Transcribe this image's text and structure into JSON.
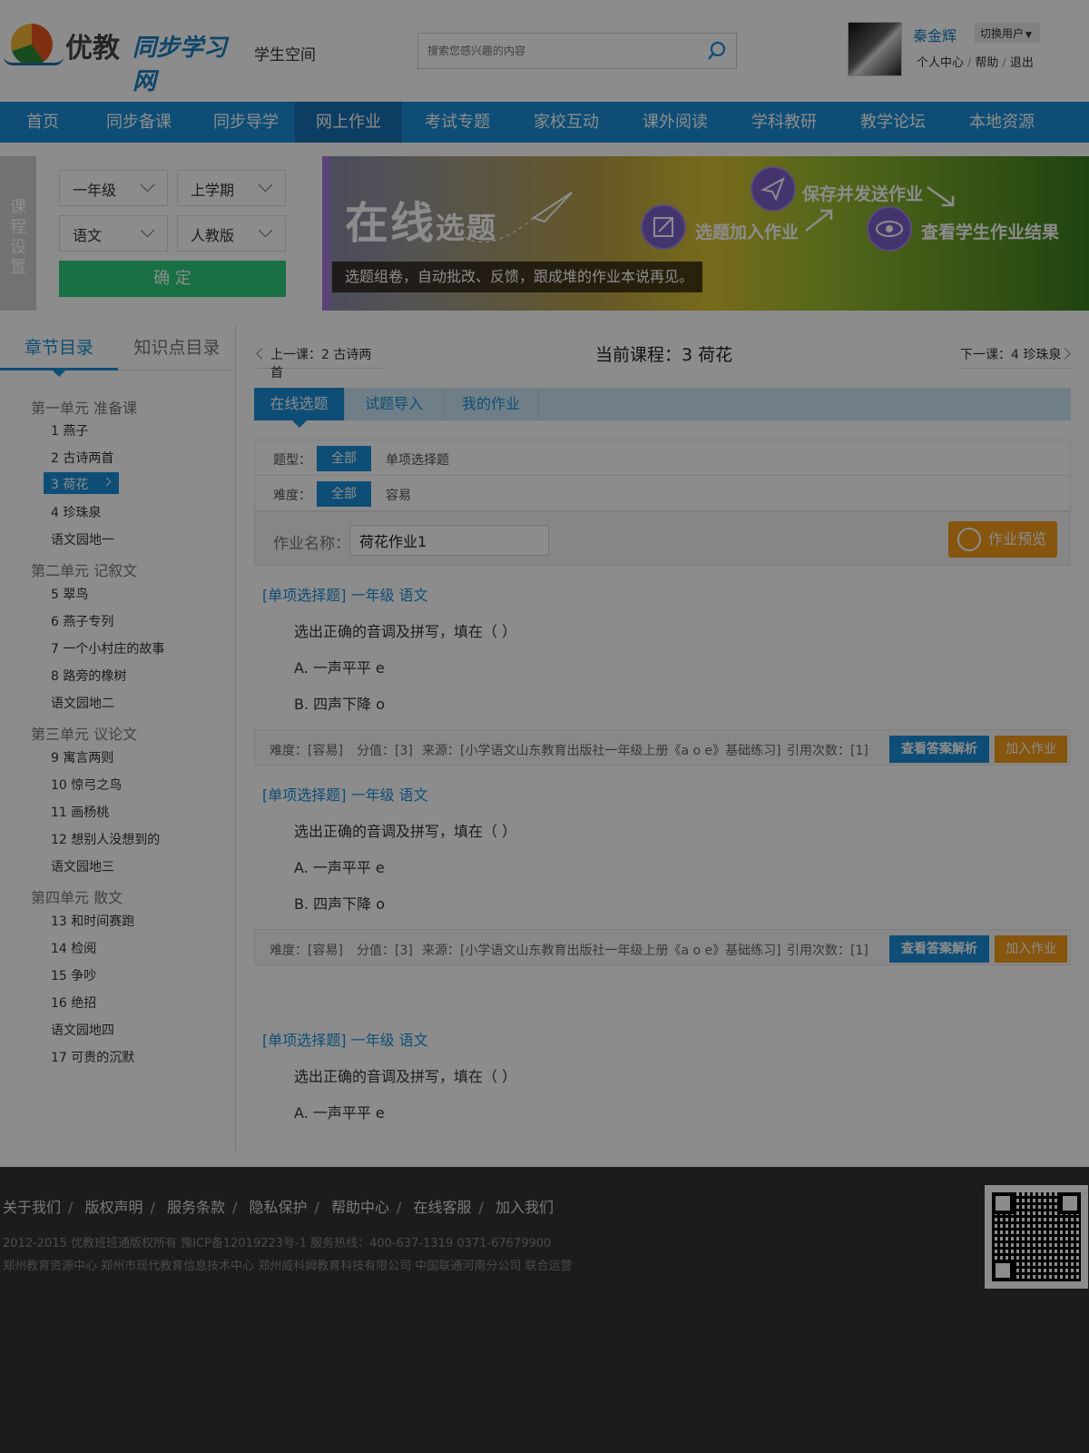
{
  "header": {
    "brand1": "优教",
    "brand2": "同步学习网",
    "space": "学生空间",
    "search_placeholder": "搜索您感兴趣的内容",
    "user_name": "秦金辉",
    "switch_user": "切换用户",
    "links": [
      "个人中心",
      "帮助",
      "退出"
    ]
  },
  "nav": [
    "首页",
    "同步备课",
    "同步导学",
    "网上作业",
    "考试专题",
    "家校互动",
    "课外阅读",
    "学科教研",
    "教学论坛",
    "本地资源"
  ],
  "course": {
    "tab": "课程设置",
    "grade": "一年级",
    "term": "上学期",
    "subject": "语文",
    "edition": "人教版",
    "confirm": "确 定"
  },
  "banner": {
    "title_big": "在线",
    "title_small": "选题",
    "subtitle": "选题组卷，自动批改、反馈，跟成堆的作业本说再见。",
    "step1": "选题加入作业",
    "step2": "保存并发送作业",
    "step3": "查看学生作业结果"
  },
  "tree": {
    "tab_on": "章节目录",
    "tab_off": "知识点目录",
    "units": [
      {
        "name": "第一单元 准备课",
        "lessons": [
          "1 燕子",
          "2 古诗两首",
          "3 荷花",
          "4 珍珠泉",
          "语文园地一"
        ]
      },
      {
        "name": "第二单元 记叙文",
        "lessons": [
          "5 翠鸟",
          "6 燕子专列",
          "7 一个小村庄的故事",
          "8 路旁的橡树",
          "语文园地二"
        ]
      },
      {
        "name": "第三单元 议论文",
        "lessons": [
          "9 寓言两则",
          "10 惊弓之鸟",
          "11 画杨桃",
          "12 想别人没想到的",
          "语文园地三"
        ]
      },
      {
        "name": "第四单元 散文",
        "lessons": [
          "13 和时间赛跑",
          "14 检阅",
          "15 争吵",
          "16 绝招",
          "语文园地四",
          "17 可贵的沉默"
        ]
      }
    ]
  },
  "main": {
    "prev": "上一课：2 古诗两首",
    "current": "当前课程：3 荷花",
    "next": "下一课：4 珍珠泉",
    "tabs": [
      "在线选题",
      "试题导入",
      "我的作业"
    ],
    "type_label": "题型：",
    "all": "全部",
    "type_opt": "单项选择题",
    "diff_label": "难度：",
    "diff_opt": "容易",
    "hw_label": "作业名称：",
    "hw_value": "荷花作业1",
    "preview": "作业预览",
    "q_head": "[单项选择题] 一年级 语文",
    "q_text": "选出正确的音调及拼写，填在（      ）",
    "q_a": "A. 一声平平 e",
    "q_b": "B. 四声下降 o",
    "meta": {
      "diff": "难度：[容易]",
      "score": "分值：[3]",
      "source": "来源：[小学语文山东教育出版社一年级上册《a o e》基础练习]",
      "refs": "引用次数：[1]",
      "btn_answer": "查看答案解析",
      "btn_add": "加入作业"
    }
  },
  "footer": {
    "links": [
      "关于我们",
      "版权声明",
      "服务条款",
      "隐私保护",
      "帮助中心",
      "在线客服",
      "加入我们"
    ],
    "copy1": "2012-2015 优教班班通版权所有  豫ICP备12019223号-1      服务热线：400-637-1319    0371-67679900",
    "copy2": "郑州教育资源中心    郑州市现代教育信息技术中心   郑州威科姆教育科技有限公司 中国联通河南分公司  联合运营"
  }
}
